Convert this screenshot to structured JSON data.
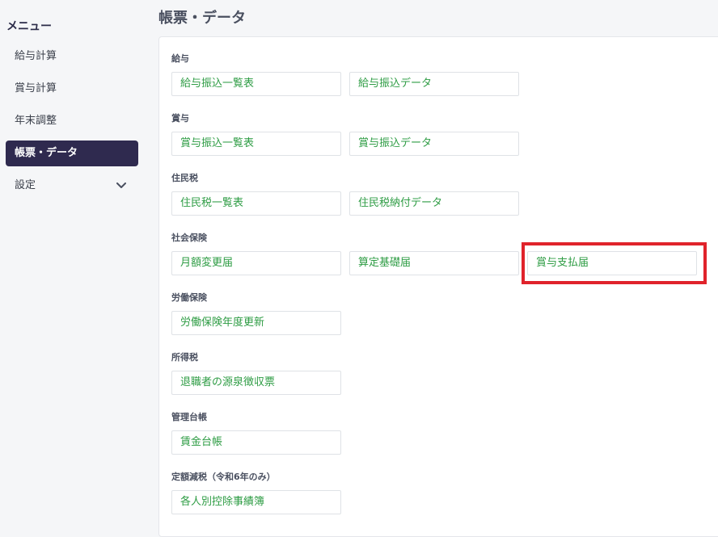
{
  "sidebar": {
    "title": "メニュー",
    "items": [
      {
        "label": "給与計算"
      },
      {
        "label": "賞与計算"
      },
      {
        "label": "年末調整"
      },
      {
        "label": "帳票・データ"
      },
      {
        "label": "設定"
      }
    ]
  },
  "header": {
    "title": "帳票・データ"
  },
  "sections": [
    {
      "label": "給与",
      "buttons": [
        {
          "label": "給与振込一覧表"
        },
        {
          "label": "給与振込データ"
        }
      ]
    },
    {
      "label": "賞与",
      "buttons": [
        {
          "label": "賞与振込一覧表"
        },
        {
          "label": "賞与振込データ"
        }
      ]
    },
    {
      "label": "住民税",
      "buttons": [
        {
          "label": "住民税一覧表"
        },
        {
          "label": "住民税納付データ"
        }
      ]
    },
    {
      "label": "社会保険",
      "buttons": [
        {
          "label": "月額変更届"
        },
        {
          "label": "算定基礎届"
        },
        {
          "label": "賞与支払届"
        }
      ]
    },
    {
      "label": "労働保険",
      "buttons": [
        {
          "label": "労働保険年度更新"
        }
      ]
    },
    {
      "label": "所得税",
      "buttons": [
        {
          "label": "退職者の源泉徴収票"
        }
      ]
    },
    {
      "label": "管理台帳",
      "buttons": [
        {
          "label": "賃金台帳"
        }
      ]
    },
    {
      "label": "定額減税（令和6年のみ）",
      "buttons": [
        {
          "label": "各人別控除事績簿"
        }
      ]
    }
  ],
  "colors": {
    "accent_link": "#2e9c44",
    "active_nav": "#2f2a4f",
    "highlight": "#e0232b"
  }
}
